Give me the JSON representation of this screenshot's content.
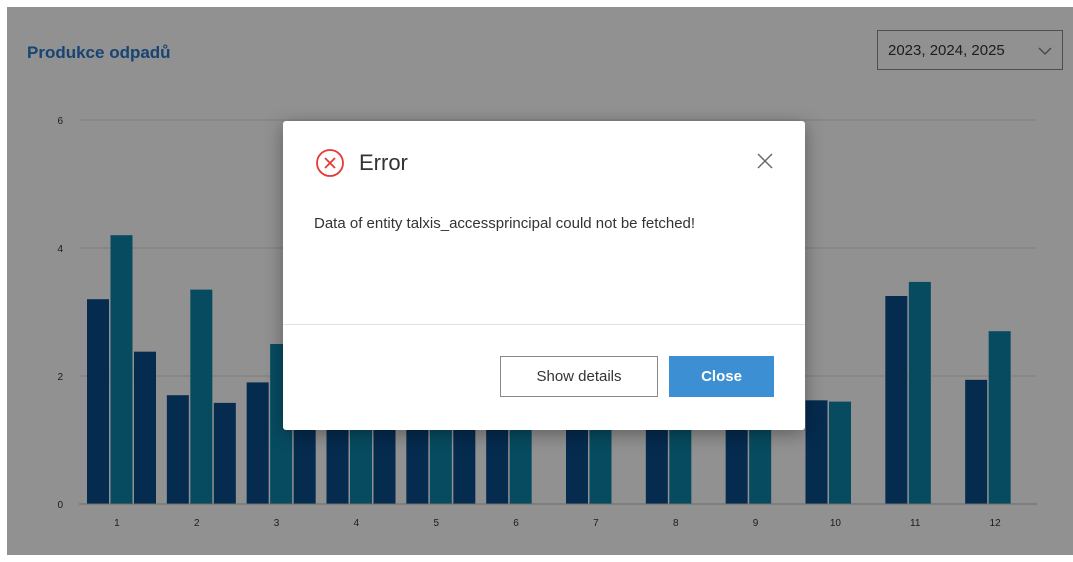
{
  "panel": {
    "title": "Produkce odpadů",
    "year_filter": {
      "selected": "2023, 2024, 2025"
    }
  },
  "chart_data": {
    "type": "bar",
    "categories": [
      "1",
      "2",
      "3",
      "4",
      "5",
      "6",
      "7",
      "8",
      "9",
      "10",
      "11",
      "12"
    ],
    "y_ticks": [
      "0",
      "2",
      "4",
      "6"
    ],
    "ylim": [
      0,
      6
    ],
    "grid": true,
    "series": [
      {
        "values": [
          3.2,
          1.7,
          1.9,
          1.6,
          1.6,
          1.6,
          1.6,
          1.6,
          1.6,
          1.62,
          3.25,
          1.94
        ],
        "color": "#0a4d8c"
      },
      {
        "values": [
          4.2,
          3.35,
          2.5,
          1.6,
          1.6,
          1.6,
          1.6,
          1.6,
          1.6,
          1.6,
          3.47,
          2.7
        ],
        "color": "#0e85ab"
      },
      {
        "values": [
          2.38,
          1.58,
          1.6,
          1.6,
          1.6,
          null,
          null,
          null,
          null,
          null,
          null,
          null
        ],
        "color": "#0a4d8c"
      }
    ]
  },
  "dialog": {
    "title": "Error",
    "message": "Data of entity talxis_accessprincipal could not be fetched!",
    "show_details_label": "Show details",
    "close_label": "Close",
    "colors": {
      "error_icon": "#e53935",
      "primary_button": "#3d8fd4"
    },
    "icons": {
      "status": "error-circle-icon",
      "dismiss": "close-icon"
    }
  }
}
